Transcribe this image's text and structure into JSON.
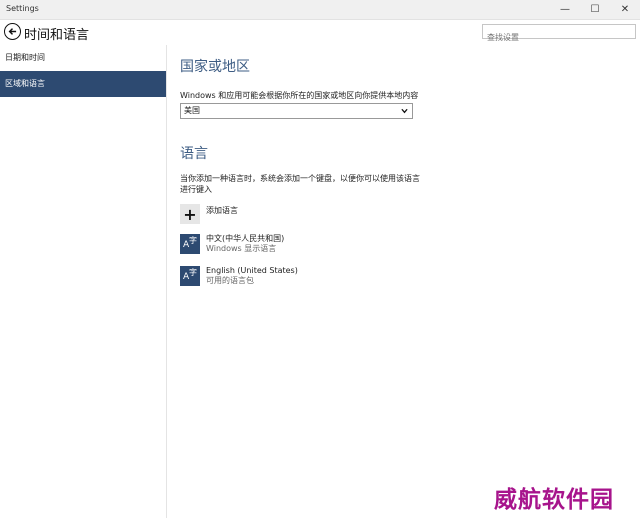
{
  "window": {
    "title": "Settings",
    "controls": [
      "—",
      "☐",
      "✕"
    ]
  },
  "header": {
    "title": "时间和语言",
    "search_placeholder": "查找设置"
  },
  "sidebar": {
    "items": [
      {
        "label": "日期和时间"
      },
      {
        "label": "区域和语言"
      }
    ]
  },
  "region": {
    "title": "国家或地区",
    "description": "Windows 和应用可能会根据你所在的国家或地区向你提供本地内容",
    "selected": "美国"
  },
  "language": {
    "title": "语言",
    "description": "当你添加一种语言时，系统会添加一个键盘，以便你可以使用该语言进行键入",
    "add_label": "添加语言",
    "items": [
      {
        "name": "中文(中华人民共和国)",
        "status": "Windows 显示语言"
      },
      {
        "name": "English (United States)",
        "status": "可用的语言包"
      }
    ],
    "icon_a": "A",
    "icon_zi": "字"
  },
  "watermark": "威航软件园",
  "colors": {
    "accent": "#2d4a71",
    "section_title": "#3e5d84",
    "watermark": "#a7148c"
  }
}
